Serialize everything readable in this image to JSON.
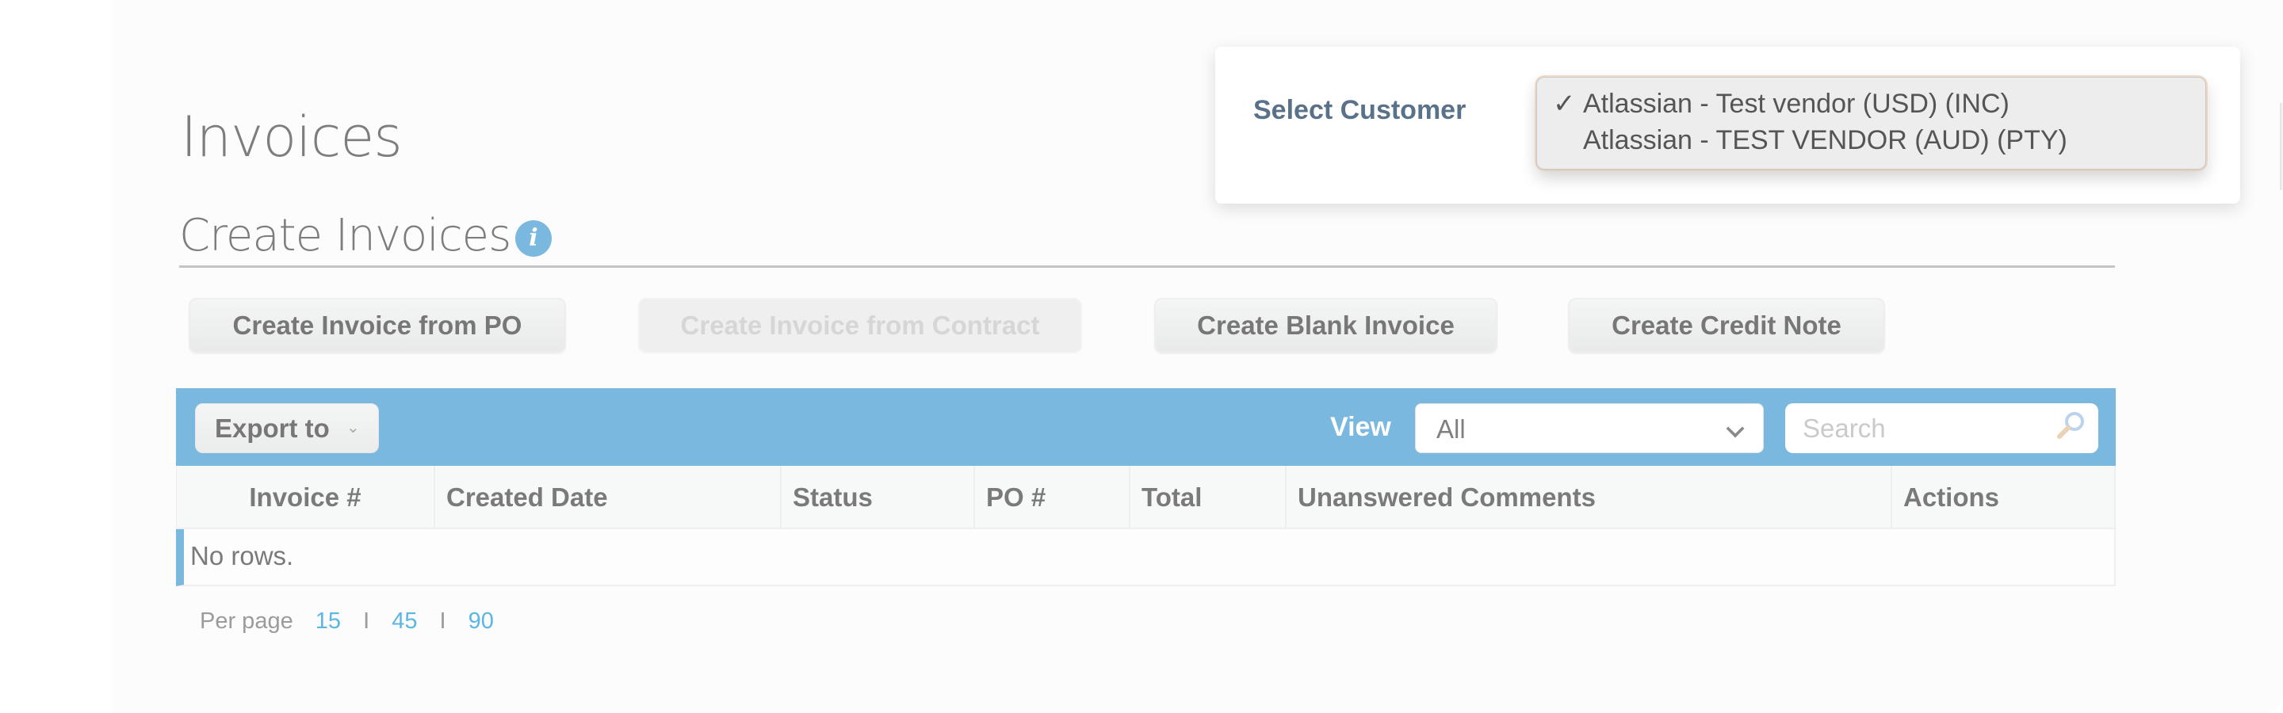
{
  "page": {
    "title": "Invoices"
  },
  "section": {
    "title": "Create Invoices",
    "info_icon": "info-icon",
    "info_glyph": "i"
  },
  "actions": {
    "create_from_po": {
      "label": "Create Invoice from PO",
      "enabled": true
    },
    "create_from_contract": {
      "label": "Create Invoice from Contract",
      "enabled": false
    },
    "create_blank": {
      "label": "Create Blank Invoice",
      "enabled": true
    },
    "create_credit_note": {
      "label": "Create Credit Note",
      "enabled": true
    }
  },
  "toolbar": {
    "export_label": "Export to",
    "export_chevron": "⌄",
    "view_label": "View",
    "view_selected": "All",
    "search_placeholder": "Search",
    "search_value": ""
  },
  "table": {
    "columns": [
      {
        "label": "Invoice #"
      },
      {
        "label": "Created Date"
      },
      {
        "label": "Status"
      },
      {
        "label": "PO #"
      },
      {
        "label": "Total"
      },
      {
        "label": "Unanswered Comments"
      },
      {
        "label": "Actions"
      }
    ],
    "rows": [],
    "empty_message": "No rows."
  },
  "pagination": {
    "label": "Per page",
    "options": [
      "15",
      "45",
      "90"
    ],
    "separator": "I"
  },
  "customer_select": {
    "label": "Select Customer",
    "check_glyph": "✓",
    "options": [
      {
        "label": "Atlassian - Test vendor (USD) (INC)",
        "selected": true
      },
      {
        "label": "Atlassian - TEST VENDOR (AUD) (PTY)",
        "selected": false
      }
    ]
  },
  "colors": {
    "accent": "#7ab8e0",
    "link": "#5bb6e6",
    "label_blue_gray": "#5a7289",
    "text_gray": "#7a7a7a"
  }
}
